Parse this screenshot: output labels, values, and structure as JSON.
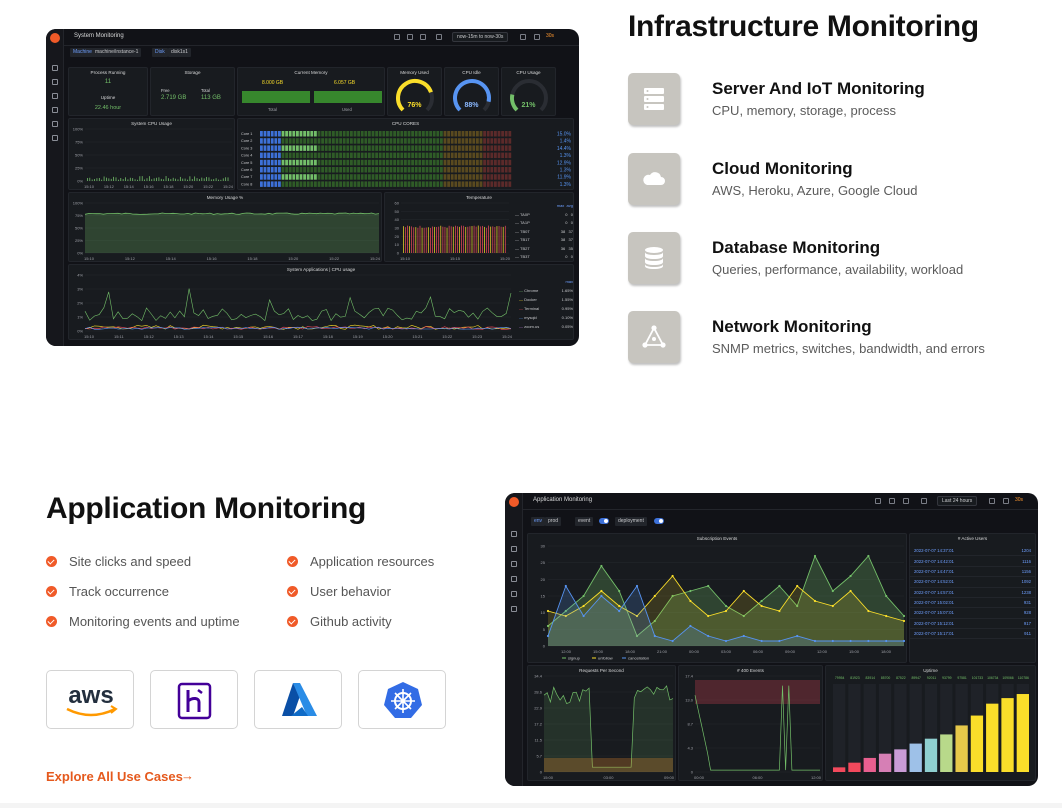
{
  "infrastructure": {
    "title": "Infrastructure Monitoring",
    "items": [
      {
        "name": "Server And IoT Monitoring",
        "desc": "CPU, memory, storage, process",
        "icon": "server-icon"
      },
      {
        "name": "Cloud Monitoring",
        "desc": "AWS, Heroku, Azure, Google Cloud",
        "icon": "cloud-icon"
      },
      {
        "name": "Database Monitoring",
        "desc": "Queries, performance, availability, workload",
        "icon": "database-icon"
      },
      {
        "name": "Network Monitoring",
        "desc": "SNMP metrics, switches, bandwidth, and errors",
        "icon": "network-icon"
      }
    ]
  },
  "application": {
    "title": "Application Monitoring",
    "features_left": [
      "Site clicks and speed",
      "Track occurrence",
      "Monitoring events and uptime"
    ],
    "features_right": [
      "Application resources",
      "User behavior",
      "Github activity"
    ],
    "logos": [
      "aws",
      "heroku",
      "azure",
      "kubernetes"
    ],
    "logo_aws_text": "aws",
    "explore_label": "Explore All Use Cases",
    "explore_arrow": "→"
  },
  "dashboard_system": {
    "title": "System Monitoring",
    "time_range": "now-15m to now-30s",
    "refresh": "30s",
    "vars": {
      "machine_label": "Machine",
      "machine_value": "machine/instance-1",
      "disk_label": "Disk",
      "disk_value": "disk1s1"
    },
    "stats": {
      "process_title": "Process Running",
      "process_value": "11",
      "uptime_title": "Uptime",
      "uptime_value": "22.46 hour",
      "storage_title": "Storage",
      "storage_free_label": "Free",
      "storage_free": "2.719 GB",
      "storage_total_label": "Total",
      "storage_total": "113 GB",
      "memory_title": "Current Memory",
      "memory_total": "8.000 GB",
      "memory_used": "6.057 GB",
      "memory_total_label": "Total",
      "memory_used_label": "Used",
      "mem_used_title": "Memory Used",
      "mem_used_pct": "76%",
      "mem_used_level": 0.76,
      "cpu_idle_title": "CPU Idle",
      "cpu_idle_pct": "88%",
      "cpu_idle_level": 0.88,
      "cpu_usage_title": "CPU Usage",
      "cpu_usage_pct": "21%",
      "cpu_usage_level": 0.21
    },
    "panels": {
      "sys_cpu": "System CPU Usage",
      "cpu_cores": "CPU CORES",
      "mem_usage": "Memory Usage %",
      "temperature": "Temperature",
      "sys_apps": "System Applications | CPU usage"
    },
    "cores": [
      "Core 1",
      "Core 2",
      "Core 3",
      "Core 4",
      "Core 5",
      "Core 6",
      "Core 7",
      "Core 8"
    ],
    "core_values": [
      "15.0%",
      "1.4%",
      "14.4%",
      "1.3%",
      "12.9%",
      "1.3%",
      "11.9%",
      "1.3%"
    ],
    "temp_legend": [
      {
        "name": "TA0P",
        "max": "0",
        "avg": "0"
      },
      {
        "name": "TA1P",
        "max": "0",
        "avg": "0"
      },
      {
        "name": "TB0T",
        "max": "38",
        "avg": "37"
      },
      {
        "name": "TB1T",
        "max": "38",
        "avg": "37"
      },
      {
        "name": "TB2T",
        "max": "36",
        "avg": "35"
      },
      {
        "name": "TB3T",
        "max": "0",
        "avg": "0"
      }
    ],
    "temp_legend_headers": {
      "max": "max",
      "avg": "avg"
    },
    "apps_legend_header": "max",
    "apps_legend": [
      {
        "name": "Chrome",
        "value": "1.65%"
      },
      {
        "name": "Docker",
        "value": "1.55%"
      },
      {
        "name": "Terminal",
        "value": "0.95%"
      },
      {
        "name": "mysqld",
        "value": "0.10%"
      },
      {
        "name": "zoom.us",
        "value": "0.05%"
      }
    ],
    "cpu_y": [
      "100%",
      "75%",
      "50%",
      "25%",
      "0%"
    ],
    "cpu_x": [
      "15:10",
      "15:12",
      "15:14",
      "15:16",
      "15:18",
      "15:20",
      "15:22",
      "15:24"
    ],
    "mem_y": [
      "100%",
      "75%",
      "50%",
      "25%",
      "0%"
    ],
    "mem_x": [
      "15:10",
      "15:12",
      "15:14",
      "15:16",
      "15:18",
      "15:20",
      "15:22",
      "15:24"
    ],
    "temp_y": [
      "60",
      "50",
      "40",
      "30",
      "20",
      "10",
      "0"
    ],
    "temp_x": [
      "15:10",
      "15:15",
      "15:20"
    ],
    "apps_y": [
      "4%",
      "3%",
      "2%",
      "1%",
      "0%"
    ],
    "apps_x": [
      "15:10",
      "15:11",
      "15:12",
      "15:13",
      "15:14",
      "15:15",
      "15:16",
      "15:17",
      "15:18",
      "15:19",
      "15:20",
      "15:21",
      "15:22",
      "15:23",
      "15:24"
    ]
  },
  "dashboard_app": {
    "title": "Application Monitoring",
    "time_range": "Last 24 hours",
    "refresh": "30s",
    "vars": {
      "env_label": "env",
      "env_value": "prod",
      "event_label": "event",
      "deploy_label": "deployment"
    },
    "panels": {
      "subscription": "Subscription Events",
      "active_users": "# Active Users",
      "requests": "Requests Per Second",
      "errors": "# 400 Events",
      "uptime": "Uptime"
    },
    "legend": [
      "signup",
      "unfollow",
      "cancellation"
    ],
    "sub_y": [
      "30",
      "25",
      "20",
      "15",
      "10",
      "5",
      "0"
    ],
    "sub_x": [
      "12:00",
      "15:00",
      "18:00",
      "21:00",
      "00:00",
      "03:00",
      "06:00",
      "09:00",
      "12:00",
      "15:00",
      "18:00"
    ],
    "active_users": [
      {
        "time": "2022-07-07 14:37:01",
        "count": "1204"
      },
      {
        "time": "2022-07-07 14:42:01",
        "count": "1116"
      },
      {
        "time": "2022-07-07 14:47:01",
        "count": "1156"
      },
      {
        "time": "2022-07-07 14:52:01",
        "count": "1092"
      },
      {
        "time": "2022-07-07 14:57:01",
        "count": "1238"
      },
      {
        "time": "2022-07-07 15:02:01",
        "count": "931"
      },
      {
        "time": "2022-07-07 15:07:01",
        "count": "928"
      },
      {
        "time": "2022-07-07 15:12:01",
        "count": "917"
      },
      {
        "time": "2022-07-07 15:17:01",
        "count": "911"
      }
    ],
    "rps_y": [
      "34.4",
      "28.6",
      "22.9",
      "17.2",
      "11.5",
      "5.7",
      "0"
    ],
    "rps_x": [
      "15:00",
      "03:00",
      "09:00"
    ],
    "err_y": [
      "17.4",
      "13.0",
      "8.7",
      "4.3",
      "0"
    ],
    "err_x": [
      "00:00",
      "06:00",
      "12:00"
    ],
    "uptime_values": [
      "79954",
      "81923",
      "83914",
      "85700",
      "87522",
      "89947",
      "92011",
      "93799",
      "97581",
      "101733",
      "106734",
      "109066",
      "110786"
    ]
  },
  "colors": {
    "accent": "#f05a28",
    "dash_bg": "#111217",
    "panel_bg": "#181b1f",
    "green": "#73bf69",
    "yellow": "#fade2a",
    "blue": "#5794f2",
    "red": "#f2495c",
    "orange": "#ff9830"
  }
}
